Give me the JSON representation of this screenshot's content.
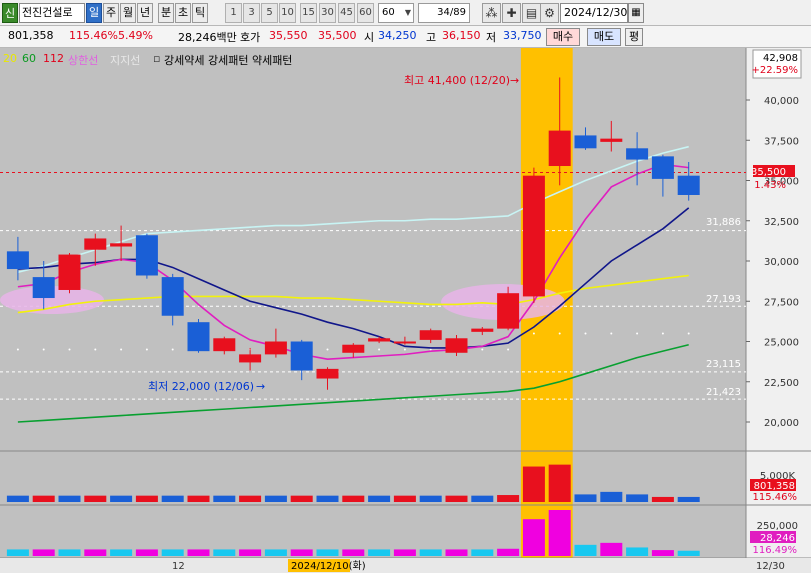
{
  "toolbar": {
    "badge": "신",
    "stock_name": "전진건설로",
    "periods": [
      "일",
      "주",
      "월",
      "년",
      "분",
      "초",
      "틱"
    ],
    "active_period": "일",
    "minute_options": [
      "1",
      "3",
      "5",
      "10",
      "15",
      "30",
      "45",
      "60"
    ],
    "minute_select": "60",
    "count": "34/89",
    "date": "2024/12/30"
  },
  "quote": {
    "volume": "801,358",
    "volume_ratio": "115.46%",
    "change_rate": "5.49%",
    "amount": "28,246백만",
    "ask_label": "호가",
    "ask_value": "35,550",
    "price": "35,500",
    "open_label": "시",
    "open_value": "34,250",
    "high_label": "고",
    "high_value": "36,150",
    "low_label": "저",
    "low_value": "33,750",
    "buy_label": "매수",
    "sell_label": "매도",
    "eval_label": "평"
  },
  "legend": {
    "ma20": "20",
    "ma60": "60",
    "ma112": "112",
    "upper_line": "상한선",
    "support_line": "지지선",
    "pattern_text": "강세약세 강세패턴  약세패턴"
  },
  "annotations": {
    "high_note": "최고 41,400 (12/20)",
    "low_note": "최저 22,000 (12/06)"
  },
  "chart_labels": {
    "top_price": "42,908",
    "top_pct": "+22.59%",
    "current_price": "35,500",
    "current_pct": "1.43%",
    "level_1": "31,886",
    "level_2": "27,193",
    "level_3": "23,115",
    "level_4": "21,423",
    "volume_value": "801,358",
    "volume_pct": "115.46%",
    "amount_value": "28,246",
    "amount_pct": "116.49%",
    "volume_axis": "5,000K",
    "amount_axis": "250,000",
    "xaxis_month": "12",
    "xaxis_cursor": "2024/12/10(화)",
    "xaxis_end": "12/30"
  },
  "colors": {
    "up": "#e8101e",
    "down": "#1a5fd6",
    "ma20": "#e01ec0",
    "ma60": "#10168a",
    "ma112": "#f2f20a",
    "ma_green": "#08a030",
    "ma_light": "#c8f4f4",
    "highlight": "#ffc000"
  },
  "chart_data": {
    "type": "candlestick",
    "y_axis": {
      "ticks": [
        20000,
        22500,
        25000,
        27500,
        30000,
        32500,
        35000,
        37500,
        40000
      ],
      "tick_labels": [
        "20,000",
        "22,500",
        "25,000",
        "27,500",
        "30,000",
        "32,500",
        "35,000",
        "37,500",
        "40,000"
      ]
    },
    "candles": [
      {
        "o": 30600,
        "h": 31500,
        "l": 28800,
        "c": 29500
      },
      {
        "o": 29000,
        "h": 30000,
        "l": 27000,
        "c": 27700
      },
      {
        "o": 28200,
        "h": 30500,
        "l": 28000,
        "c": 30400
      },
      {
        "o": 30700,
        "h": 31700,
        "l": 29700,
        "c": 31400
      },
      {
        "o": 30900,
        "h": 32200,
        "l": 30000,
        "c": 31100
      },
      {
        "o": 31600,
        "h": 31700,
        "l": 28900,
        "c": 29100
      },
      {
        "o": 29000,
        "h": 29200,
        "l": 26000,
        "c": 26600
      },
      {
        "o": 26200,
        "h": 26400,
        "l": 24300,
        "c": 24400
      },
      {
        "o": 24400,
        "h": 25300,
        "l": 24200,
        "c": 25200
      },
      {
        "o": 23700,
        "h": 24600,
        "l": 23200,
        "c": 24200
      },
      {
        "o": 24200,
        "h": 25800,
        "l": 24000,
        "c": 25000
      },
      {
        "o": 25000,
        "h": 25100,
        "l": 22600,
        "c": 23200
      },
      {
        "o": 22700,
        "h": 23400,
        "l": 22000,
        "c": 23300
      },
      {
        "o": 24300,
        "h": 24900,
        "l": 24000,
        "c": 24800
      },
      {
        "o": 25000,
        "h": 25300,
        "l": 24900,
        "c": 25200
      },
      {
        "o": 25000,
        "h": 25300,
        "l": 24800,
        "c": 25000
      },
      {
        "o": 25100,
        "h": 25800,
        "l": 24900,
        "c": 25700
      },
      {
        "o": 24300,
        "h": 25400,
        "l": 24100,
        "c": 25200
      },
      {
        "o": 25600,
        "h": 25900,
        "l": 25400,
        "c": 25800
      },
      {
        "o": 25800,
        "h": 28400,
        "l": 25700,
        "c": 28000
      },
      {
        "o": 27800,
        "h": 35800,
        "l": 27400,
        "c": 35300
      },
      {
        "o": 35900,
        "h": 41400,
        "l": 34700,
        "c": 38100
      },
      {
        "o": 37800,
        "h": 38300,
        "l": 36900,
        "c": 37000
      },
      {
        "o": 37400,
        "h": 38700,
        "l": 36800,
        "c": 37600
      },
      {
        "o": 37000,
        "h": 38000,
        "l": 34700,
        "c": 36300
      },
      {
        "o": 36500,
        "h": 36600,
        "l": 34000,
        "c": 35100
      },
      {
        "o": 35300,
        "h": 36150,
        "l": 33750,
        "c": 34100
      }
    ],
    "ma20": [
      28400,
      28600,
      29300,
      29800,
      30100,
      29900,
      28800,
      27300,
      26000,
      25100,
      24700,
      24200,
      23900,
      24000,
      24100,
      24200,
      24400,
      24500,
      24700,
      25300,
      27500,
      30200,
      32600,
      34600,
      35400,
      36000,
      35800
    ],
    "ma60": [
      29500,
      29600,
      29800,
      29900,
      30100,
      30100,
      29600,
      28900,
      28200,
      27500,
      27100,
      26700,
      26200,
      25800,
      25300,
      24700,
      24600,
      24600,
      24700,
      24900,
      25900,
      27200,
      28600,
      30000,
      31000,
      32000,
      33300
    ],
    "ma112": [
      26800,
      27000,
      27300,
      27500,
      27600,
      27700,
      27800,
      27800,
      27800,
      27800,
      27800,
      27700,
      27700,
      27600,
      27500,
      27400,
      27300,
      27300,
      27400,
      27300,
      27600,
      28000,
      28300,
      28500,
      28700,
      28900,
      29100
    ],
    "ma_green": [
      20000,
      20100,
      20200,
      20300,
      20400,
      20500,
      20600,
      20700,
      20800,
      20900,
      21000,
      21100,
      21200,
      21300,
      21400,
      21500,
      21600,
      21700,
      21800,
      21900,
      22100,
      22500,
      23000,
      23500,
      24000,
      24400,
      24800
    ],
    "ma_light": [
      29300,
      29700,
      30200,
      30700,
      31200,
      31700,
      31800,
      31900,
      32000,
      32100,
      32200,
      32200,
      32300,
      32400,
      32500,
      32500,
      32600,
      32600,
      32700,
      32800,
      33600,
      34300,
      35000,
      35600,
      36200,
      36700,
      37100
    ],
    "volume": [
      1,
      1,
      1,
      1,
      1,
      1,
      1,
      1,
      1,
      1,
      1,
      1,
      1,
      1,
      1,
      1,
      1,
      1,
      1,
      1.1,
      5.6,
      5.9,
      1.2,
      1.6,
      1.2,
      0.8,
      0.8
    ],
    "amount": [
      1,
      1,
      1,
      1,
      1,
      1,
      1,
      1,
      1,
      1,
      1,
      1,
      1,
      1,
      1,
      1,
      1,
      1,
      1,
      1.1,
      5.6,
      7.0,
      1.7,
      2.0,
      1.3,
      0.9,
      0.8
    ]
  }
}
